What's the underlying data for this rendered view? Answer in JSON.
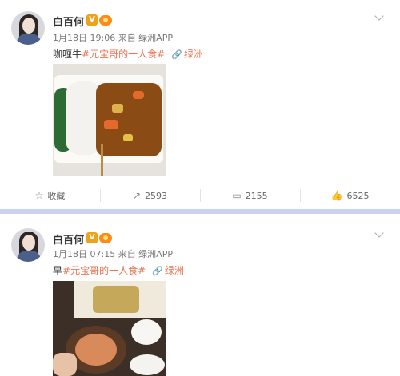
{
  "posts": [
    {
      "author": "白百何",
      "verified_mark": "V",
      "meta": "1月18日 19:06 来自 绿洲APP",
      "text_prefix": "咖喱牛",
      "tag": "#元宝哥的一人食#",
      "link": "绿洲",
      "actions": {
        "favorite": "收藏",
        "reposts": "2593",
        "comments": "2155",
        "likes": "6525"
      }
    },
    {
      "author": "白百何",
      "verified_mark": "V",
      "meta": "1月18日 07:15 来自 绿洲APP",
      "text_prefix": "早",
      "tag": "#元宝哥的一人食#",
      "link": "绿洲"
    }
  ],
  "icons": {
    "favorite": "star-outline-icon",
    "repost": "share-icon",
    "comment": "comment-icon",
    "like": "thumbs-up-icon",
    "link": "link-icon",
    "more": "chevron-down-icon"
  },
  "colors": {
    "tag": "#eb7350",
    "verified": "#f0a11b",
    "divider": "#c9d2ee"
  }
}
